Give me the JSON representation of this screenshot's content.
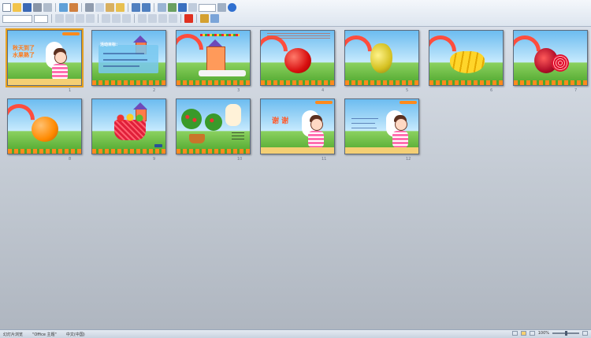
{
  "toolbar": {
    "row1_buttons": [
      "new-icon",
      "open-icon",
      "save-icon",
      "print-icon",
      "print-preview-icon",
      "spelling-icon",
      "research-icon",
      "cut-icon",
      "copy-icon",
      "paste-icon",
      "format-painter-icon",
      "undo-icon",
      "redo-icon",
      "insert-table-icon",
      "insert-chart-icon",
      "hyperlink-icon",
      "show-grid-icon",
      "zoom-icon",
      "help-icon"
    ],
    "row2_buttons": [
      "bold-icon",
      "italic-icon",
      "underline-icon",
      "shadow-icon",
      "align-left-icon",
      "align-center-icon",
      "align-right-icon",
      "bullets-icon",
      "numbering-icon",
      "increase-font-icon",
      "decrease-font-icon",
      "font-color-icon",
      "design-icon",
      "new-slide-icon"
    ],
    "font_name": "",
    "font_size": ""
  },
  "slides": [
    {
      "num": "1",
      "title": "秋天到了\n水果熟了"
    },
    {
      "num": "2",
      "title": "活动目标："
    },
    {
      "num": "3",
      "title": ""
    },
    {
      "num": "4",
      "title": ""
    },
    {
      "num": "5",
      "title": ""
    },
    {
      "num": "6",
      "title": ""
    },
    {
      "num": "7",
      "title": ""
    },
    {
      "num": "8",
      "title": ""
    },
    {
      "num": "9",
      "title": ""
    },
    {
      "num": "10",
      "title": ""
    },
    {
      "num": "11",
      "title": "谢 谢"
    },
    {
      "num": "12",
      "title": ""
    }
  ],
  "statusbar": {
    "view": "幻灯片浏览",
    "template": "\"Office 主题\"",
    "language": "中文(中国)",
    "zoom": "100%"
  },
  "colors": {
    "selection": "#e7a11f",
    "title_orange": "#ff7a1a",
    "sky": "#6cbcf0",
    "grass": "#4ea62c"
  }
}
